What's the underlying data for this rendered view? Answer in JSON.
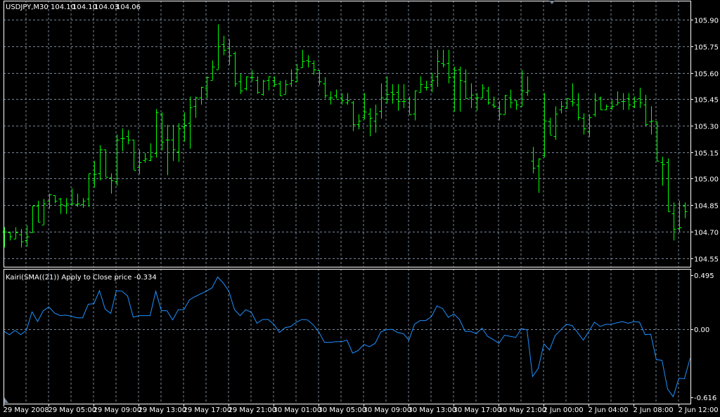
{
  "header": {
    "symbol": "USDJPY,M30",
    "open": "104.10",
    "high": "104.10",
    "low": "104.03",
    "close": "104.06"
  },
  "indicator": {
    "title": "Kairi(SMA((21)) Apply to Close price -0.334",
    "axis_labels": [
      "0.495",
      "0.00",
      "-0.616"
    ]
  },
  "price_axis": [
    "105.90",
    "105.75",
    "105.60",
    "105.45",
    "105.30",
    "105.15",
    "105.00",
    "104.85",
    "104.70",
    "104.55"
  ],
  "time_axis": [
    "29 May 2008",
    "29 May 05:00",
    "29 May 09:00",
    "29 May 13:00",
    "29 May 17:00",
    "29 May 21:00",
    "30 May 01:00",
    "30 May 05:00",
    "30 May 09:00",
    "30 May 13:00",
    "30 May 17:00",
    "30 May 21:00",
    "2 Jun 00:00",
    "2 Jun 04:00",
    "2 Jun 08:00",
    "2 Jun 12:00"
  ],
  "colors": {
    "bars": "#00ff00",
    "indicator": "#1e90ff",
    "grid": "#778899",
    "frame": "#ffffff"
  },
  "chart_data": {
    "type": "ohlc",
    "price_range": [
      104.55,
      105.9
    ],
    "ohlc": [
      [
        104.7,
        104.725,
        104.61,
        104.7
      ],
      [
        104.695,
        104.7,
        104.65,
        104.67
      ],
      [
        104.66,
        104.725,
        104.66,
        104.695
      ],
      [
        104.685,
        104.715,
        104.61,
        104.645
      ],
      [
        104.65,
        104.735,
        104.615,
        104.67
      ],
      [
        104.695,
        104.845,
        104.695,
        104.845
      ],
      [
        104.845,
        104.875,
        104.755,
        104.755
      ],
      [
        104.74,
        104.885,
        104.74,
        104.86
      ],
      [
        104.875,
        104.915,
        104.83,
        104.91
      ],
      [
        104.905,
        104.905,
        104.86,
        104.875
      ],
      [
        104.885,
        104.89,
        104.8,
        104.855
      ],
      [
        104.845,
        104.89,
        104.8,
        104.86
      ],
      [
        104.855,
        104.945,
        104.855,
        104.86
      ],
      [
        104.855,
        104.915,
        104.84,
        104.86
      ],
      [
        104.855,
        104.89,
        104.835,
        104.875
      ],
      [
        104.885,
        105.03,
        104.84,
        105.03
      ],
      [
        104.99,
        105.1,
        104.95,
        105.025
      ],
      [
        105.03,
        105.19,
        104.99,
        105.165
      ],
      [
        105.165,
        105.165,
        105.01,
        105.01
      ],
      [
        105.005,
        105.03,
        104.915,
        104.99
      ],
      [
        104.985,
        105.25,
        104.96,
        105.22
      ],
      [
        105.23,
        105.285,
        105.155,
        105.23
      ],
      [
        105.24,
        105.275,
        105.195,
        105.22
      ],
      [
        105.22,
        105.22,
        105.05,
        105.05
      ],
      [
        105.065,
        105.165,
        105.025,
        105.095
      ],
      [
        105.105,
        105.145,
        105.09,
        105.115
      ],
      [
        105.105,
        105.2,
        105.1,
        105.125
      ],
      [
        105.145,
        105.395,
        105.12,
        105.375
      ],
      [
        105.37,
        105.375,
        105.16,
        105.21
      ],
      [
        105.22,
        105.305,
        105.02,
        105.22
      ],
      [
        105.22,
        105.305,
        105.1,
        105.165
      ],
      [
        105.155,
        105.315,
        105.095,
        105.285
      ],
      [
        105.295,
        105.375,
        105.21,
        105.305
      ],
      [
        105.315,
        105.465,
        105.17,
        105.405
      ],
      [
        105.41,
        105.465,
        105.345,
        105.46
      ],
      [
        105.46,
        105.52,
        105.42,
        105.52
      ],
      [
        105.515,
        105.58,
        105.455,
        105.575
      ],
      [
        105.56,
        105.67,
        105.56,
        105.635
      ],
      [
        105.62,
        105.875,
        105.62,
        105.75
      ],
      [
        105.76,
        105.81,
        105.7,
        105.73
      ],
      [
        105.74,
        105.79,
        105.645,
        105.7
      ],
      [
        105.71,
        105.72,
        105.52,
        105.54
      ],
      [
        105.55,
        105.595,
        105.48,
        105.5
      ],
      [
        105.51,
        105.58,
        105.5,
        105.58
      ],
      [
        105.575,
        105.615,
        105.55,
        105.575
      ],
      [
        105.56,
        105.58,
        105.48,
        105.49
      ],
      [
        105.48,
        105.56,
        105.47,
        105.555
      ],
      [
        105.56,
        105.58,
        105.5,
        105.58
      ],
      [
        105.56,
        105.58,
        105.52,
        105.535
      ],
      [
        105.54,
        105.555,
        105.47,
        105.47
      ],
      [
        105.48,
        105.56,
        105.48,
        105.535
      ],
      [
        105.54,
        105.62,
        105.52,
        105.56
      ],
      [
        105.55,
        105.65,
        105.55,
        105.62
      ],
      [
        105.63,
        105.73,
        105.63,
        105.665
      ],
      [
        105.67,
        105.7,
        105.63,
        105.665
      ],
      [
        105.655,
        105.67,
        105.59,
        105.62
      ],
      [
        105.615,
        105.615,
        105.53,
        105.55
      ],
      [
        105.54,
        105.575,
        105.455,
        105.47
      ],
      [
        105.46,
        105.495,
        105.42,
        105.46
      ],
      [
        105.47,
        105.505,
        105.455,
        105.45
      ],
      [
        105.46,
        105.485,
        105.42,
        105.445
      ],
      [
        105.43,
        105.485,
        105.42,
        105.445
      ],
      [
        105.43,
        105.44,
        105.27,
        105.31
      ],
      [
        105.31,
        105.365,
        105.28,
        105.33
      ],
      [
        105.35,
        105.485,
        105.335,
        105.38
      ],
      [
        105.37,
        105.4,
        105.24,
        105.345
      ],
      [
        105.33,
        105.42,
        105.26,
        105.37
      ],
      [
        105.385,
        105.54,
        105.34,
        105.46
      ],
      [
        105.45,
        105.58,
        105.425,
        105.48
      ],
      [
        105.49,
        105.535,
        105.425,
        105.48
      ],
      [
        105.49,
        105.535,
        105.385,
        105.44
      ],
      [
        105.44,
        105.535,
        105.4,
        105.44
      ],
      [
        105.45,
        105.465,
        105.365,
        105.365
      ],
      [
        105.37,
        105.5,
        105.33,
        105.5
      ],
      [
        105.49,
        105.58,
        105.49,
        105.535
      ],
      [
        105.52,
        105.555,
        105.5,
        105.52
      ],
      [
        105.535,
        105.6,
        105.49,
        105.56
      ],
      [
        105.58,
        105.73,
        105.52,
        105.665
      ],
      [
        105.655,
        105.73,
        105.63,
        105.645
      ],
      [
        105.655,
        105.73,
        105.54,
        105.575
      ],
      [
        105.58,
        105.635,
        105.38,
        105.615
      ],
      [
        105.62,
        105.635,
        105.38,
        105.56
      ],
      [
        105.55,
        105.62,
        105.455,
        105.455
      ],
      [
        105.46,
        105.54,
        105.4,
        105.475
      ],
      [
        105.46,
        105.485,
        105.385,
        105.46
      ],
      [
        105.46,
        105.535,
        105.455,
        105.515
      ],
      [
        105.5,
        105.52,
        105.42,
        105.43
      ],
      [
        105.42,
        105.465,
        105.4,
        105.41
      ],
      [
        105.4,
        105.44,
        105.33,
        105.37
      ],
      [
        105.365,
        105.475,
        105.365,
        105.47
      ],
      [
        105.46,
        105.505,
        105.4,
        105.43
      ],
      [
        105.445,
        105.445,
        105.39,
        105.42
      ],
      [
        105.41,
        105.615,
        105.41,
        105.5
      ],
      [
        105.49,
        105.58,
        105.47,
        105.5
      ],
      [
        105.1,
        105.18,
        105.03,
        105.06
      ],
      [
        105.075,
        105.115,
        104.92,
        105.115
      ],
      [
        105.135,
        105.485,
        105.12,
        105.33
      ],
      [
        105.325,
        105.345,
        105.25,
        105.25
      ],
      [
        105.24,
        105.41,
        105.22,
        105.37
      ],
      [
        105.39,
        105.44,
        105.37,
        105.41
      ],
      [
        105.4,
        105.455,
        105.4,
        105.455
      ],
      [
        105.44,
        105.54,
        105.41,
        105.43
      ],
      [
        105.42,
        105.485,
        105.33,
        105.35
      ],
      [
        105.345,
        105.37,
        105.25,
        105.285
      ],
      [
        105.27,
        105.365,
        105.235,
        105.35
      ],
      [
        105.365,
        105.485,
        105.35,
        105.445
      ],
      [
        105.46,
        105.465,
        105.39,
        105.39
      ],
      [
        105.39,
        105.42,
        105.39,
        105.41
      ],
      [
        105.4,
        105.445,
        105.39,
        105.41
      ],
      [
        105.42,
        105.495,
        105.42,
        105.43
      ],
      [
        105.44,
        105.485,
        105.39,
        105.44
      ],
      [
        105.455,
        105.485,
        105.39,
        105.42
      ],
      [
        105.41,
        105.465,
        105.4,
        105.44
      ],
      [
        105.455,
        105.515,
        105.4,
        105.43
      ],
      [
        105.42,
        105.475,
        105.3,
        105.31
      ],
      [
        105.325,
        105.41,
        105.25,
        105.33
      ],
      [
        105.325,
        105.325,
        105.1,
        105.1
      ],
      [
        105.095,
        105.125,
        104.96,
        105.08
      ],
      [
        105.095,
        105.115,
        104.815,
        104.815
      ],
      [
        104.805,
        104.865,
        104.65,
        104.715
      ],
      [
        104.72,
        104.875,
        104.7,
        104.725
      ],
      [
        104.845,
        104.865,
        104.775,
        104.815
      ],
      [
        104.825,
        104.995,
        104.78,
        104.82
      ]
    ],
    "kairi": {
      "range": [
        -0.616,
        0.495
      ],
      "values": [
        -0.02,
        -0.05,
        -0.01,
        -0.05,
        -0.01,
        0.16,
        0.07,
        0.17,
        0.205,
        0.15,
        0.125,
        0.13,
        0.12,
        0.105,
        0.105,
        0.23,
        0.235,
        0.355,
        0.185,
        0.145,
        0.355,
        0.35,
        0.305,
        0.11,
        0.125,
        0.125,
        0.125,
        0.35,
        0.17,
        0.17,
        0.085,
        0.18,
        0.18,
        0.27,
        0.3,
        0.325,
        0.35,
        0.38,
        0.48,
        0.425,
        0.35,
        0.18,
        0.125,
        0.18,
        0.155,
        0.055,
        0.09,
        0.09,
        0.045,
        -0.03,
        0.015,
        0.025,
        0.065,
        0.09,
        0.085,
        0.04,
        -0.025,
        -0.12,
        -0.12,
        -0.115,
        -0.115,
        -0.1,
        -0.22,
        -0.195,
        -0.14,
        -0.16,
        -0.13,
        -0.025,
        -0.005,
        0.0,
        -0.03,
        -0.04,
        -0.1,
        0.045,
        0.08,
        0.08,
        0.115,
        0.215,
        0.19,
        0.11,
        0.14,
        0.09,
        -0.02,
        -0.02,
        -0.04,
        0.01,
        -0.065,
        -0.095,
        -0.13,
        -0.055,
        -0.065,
        -0.075,
        0.005,
        -0.005,
        -0.435,
        -0.36,
        -0.135,
        -0.19,
        -0.06,
        -0.005,
        0.045,
        0.035,
        -0.03,
        -0.1,
        -0.02,
        0.065,
        0.025,
        0.045,
        0.045,
        0.06,
        0.07,
        0.055,
        0.07,
        0.065,
        -0.05,
        -0.045,
        -0.28,
        -0.285,
        -0.55,
        -0.62,
        -0.45,
        -0.455,
        -0.265
      ]
    }
  }
}
